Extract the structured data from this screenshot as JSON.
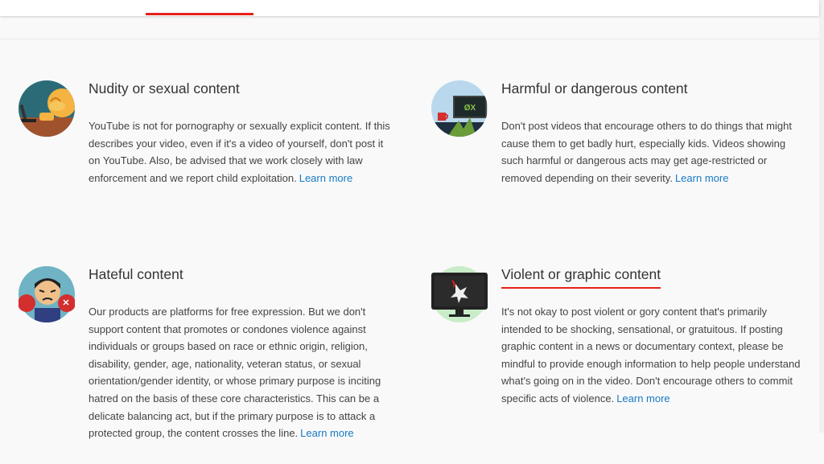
{
  "sections": [
    {
      "id": "nudity",
      "title": "Nudity or sexual content",
      "body": "YouTube is not for pornography or sexually explicit content. If this describes your video, even if it's a video of yourself, don't post it on YouTube. Also, be advised that we work closely with law enforcement and we report child exploitation.",
      "learn_more": "Learn more",
      "icon": "nudity-icon"
    },
    {
      "id": "harmful",
      "title": "Harmful or dangerous content",
      "body": "Don't post videos that encourage others to do things that might cause them to get badly hurt, especially kids. Videos showing such harmful or dangerous acts may get age-restricted or removed depending on their severity.",
      "learn_more": "Learn more",
      "icon": "dangerous-icon"
    },
    {
      "id": "hateful",
      "title": "Hateful content",
      "body": "Our products are platforms for free expression. But we don't support content that promotes or condones violence against individuals or groups based on race or ethnic origin, religion, disability, gender, age, nationality, veteran status, or sexual orientation/gender identity, or whose primary purpose is inciting hatred on the basis of these core characteristics. This can be a delicate balancing act, but if the primary purpose is to attack a protected group, the content crosses the line.",
      "learn_more": "Learn more",
      "icon": "hateful-icon"
    },
    {
      "id": "violent",
      "title": "Violent or graphic content",
      "body": "It's not okay to post violent or gory content that's primarily intended to be shocking, sensational, or gratuitous. If posting graphic content in a news or documentary context, please be mindful to provide enough information to help people understand what's going on in the video. Don't encourage others to commit specific acts of violence.",
      "learn_more": "Learn more",
      "icon": "violent-icon"
    }
  ],
  "colors": {
    "accent": "#e62117",
    "link": "#167ac6"
  }
}
